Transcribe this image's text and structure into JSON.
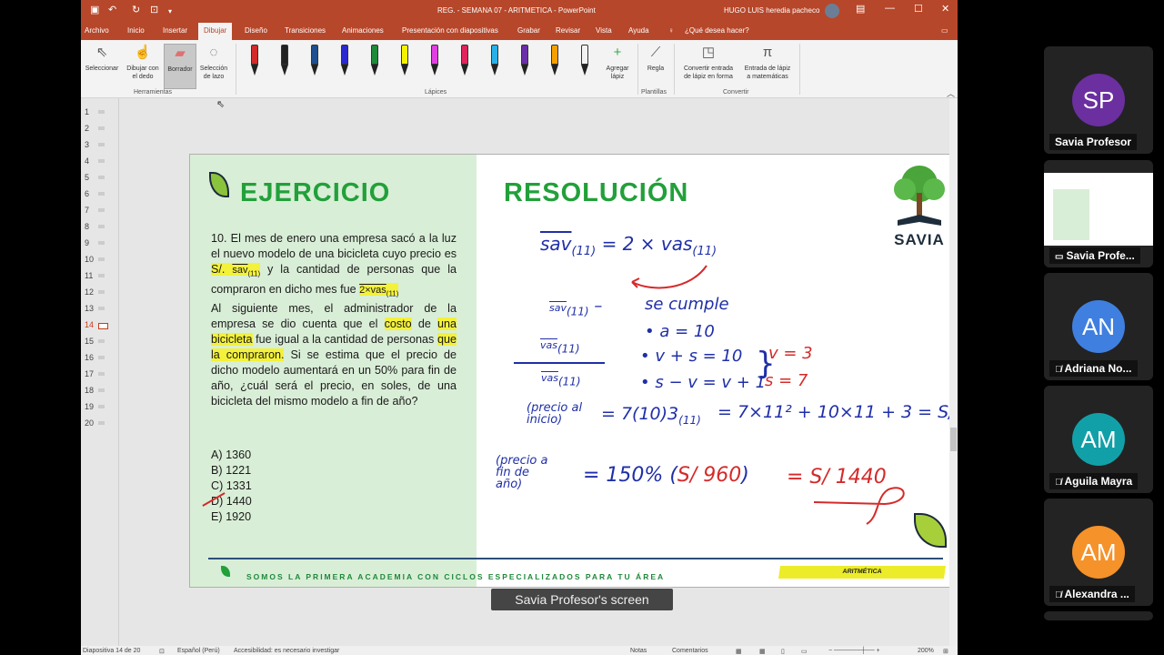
{
  "titlebar": {
    "doc_title": "REG. - SEMANA 07 - ARITMETICA  -  PowerPoint",
    "user": "HUGO LUIS heredia pacheco"
  },
  "tabs": [
    "Archivo",
    "Inicio",
    "Insertar",
    "Dibujar",
    "Diseño",
    "Transiciones",
    "Animaciones",
    "Presentación con diapositivas",
    "Grabar",
    "Revisar",
    "Vista",
    "Ayuda",
    "¿Qué desea hacer?"
  ],
  "ribbon": {
    "tools": {
      "select": "Seleccionar",
      "finger_1": "Dibujar con",
      "finger_2": "el dedo",
      "eraser": "Borrador",
      "lasso_1": "Selección",
      "lasso_2": "de lazo",
      "group": "Herramientas"
    },
    "pens_group": "Lápices",
    "add_pen_1": "Agregar",
    "add_pen_2": "lápiz",
    "ruler": "Regla",
    "templates_group": "Plantillas",
    "ink_shape_1": "Convertir entrada",
    "ink_shape_2": "de lápiz en forma",
    "ink_math_1": "Entrada de lápiz",
    "ink_math_2": "a matemáticas",
    "convert_group": "Convertir",
    "pen_colors": [
      "#d12b2b",
      "#222222",
      "#1e4f8f",
      "#2a2ad0",
      "#1f8a3a",
      "#f5f200",
      "#e040e0",
      "#e0245c",
      "#2ab0e8",
      "#6a2fa8",
      "#f5a000",
      "#f2f2f2"
    ]
  },
  "thumbnails": [
    "1",
    "2",
    "3",
    "4",
    "5",
    "6",
    "7",
    "8",
    "9",
    "10",
    "11",
    "12",
    "13",
    "14",
    "15",
    "16",
    "17",
    "18",
    "19",
    "20"
  ],
  "current_slide": "14",
  "statusbar": {
    "slide": "Diapositiva 14 de 20",
    "lang": "Español (Perú)",
    "access": "Accesibilidad: es necesario investigar",
    "notes": "Notas",
    "comments": "Comentarios",
    "zoom": "200%"
  },
  "slide": {
    "ejercicio": "EJERCICIO",
    "resolucion": "RESOLUCIÓN",
    "problem": {
      "p1": "10. El mes de enero una empresa sacó a la luz el nuevo modelo de una bicicleta cuyo precio es",
      "price": "S/.",
      "sav": "sav",
      "sub11": "(11)",
      "p2": "y la cantidad de personas que la compraron en dicho mes fue",
      "twovas": "2×vas",
      "p3a": "Al siguiente mes, el administrador de la empresa se dio cuenta que el",
      "costo": "costo",
      "p3b": "de",
      "una_bici": "una bicicleta",
      "p3c": "fue igual a la cantidad de personas",
      "que_compraron": "que la compraron.",
      "p3d": "Si se estima que el precio de dicho modelo aumentará en un 50% para fin de año, ¿cuál será el precio, en soles, de una bicicleta del mismo modelo a fin de año?"
    },
    "options": [
      "A) 1360",
      "B) 1221",
      "C) 1331",
      "D) 1440",
      "E) 1920"
    ],
    "footer": "SOMOS LA PRIMERA ACADEMIA CON CICLOS ESPECIALIZADOS PARA TU ÁREA",
    "tag": "ARITMÉTICA",
    "logo": "SAVIA",
    "hw": {
      "eq1": "sav",
      "eq1_sub": "(11)",
      "eq1_rhs": "= 2 × vas",
      "eq1_rhs_sub": "(11)",
      "frac_top": "sav",
      "frac_top_sub": "(11)",
      "minus": "–",
      "frac_mid": "vas",
      "frac_mid_sub": "(11)",
      "frac_bot": "vas",
      "frac_bot_sub": "(11)",
      "se_cumple": "se cumple",
      "c1": "• a = 10",
      "c2": "• v + s = 10",
      "c3": "• s − v = v + 1",
      "v3": "v = 3",
      "s7": "s = 7",
      "precio_al_inicio": "(precio al inicio)",
      "eq_line": "= 7(10)3",
      "eq_line_sub": "(11)",
      "eq_line2": "= 7×11² + 10×11 + 3 = ",
      "s960": "S/ 960",
      "precio_fin": "(precio a fin de año)",
      "eq_fin": "= 150% (",
      "eq_fin_mid": "S/ 960",
      "eq_fin_end": ")",
      "result": "= S/ 1440"
    }
  },
  "caption": "Savia Profesor's screen",
  "participants": [
    {
      "initials": "SP",
      "name": "Savia Profesor",
      "color": "#6b2fa0",
      "muted": false
    },
    {
      "initials": "",
      "name": "Savia Profe...",
      "color": "#ffffff",
      "muted": false,
      "screen": true
    },
    {
      "initials": "AN",
      "name": "Adriana No...",
      "color": "#3f7fe0",
      "muted": true
    },
    {
      "initials": "AM",
      "name": "Aguila Mayra",
      "color": "#12a0a8",
      "muted": true
    },
    {
      "initials": "AM",
      "name": "Alexandra ...",
      "color": "#f5922a",
      "muted": true
    }
  ]
}
